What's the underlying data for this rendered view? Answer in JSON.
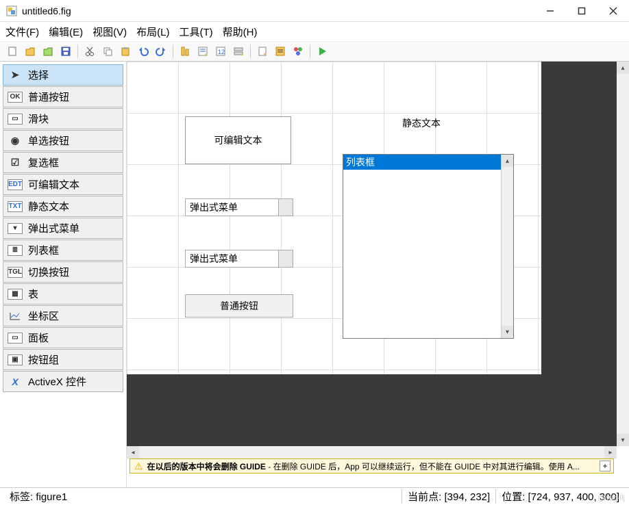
{
  "window": {
    "title": "untitled6.fig"
  },
  "menu": {
    "file": "文件(F)",
    "edit": "编辑(E)",
    "view": "视图(V)",
    "layout": "布局(L)",
    "tools": "工具(T)",
    "help": "帮助(H)"
  },
  "palette": {
    "select": "选择",
    "pushbutton": "普通按钮",
    "slider": "滑块",
    "radio": "单选按钮",
    "checkbox": "复选框",
    "edit": "可编辑文本",
    "text": "静态文本",
    "popup": "弹出式菜单",
    "listbox": "列表框",
    "toggle": "切换按钮",
    "table": "表",
    "axes": "坐标区",
    "panel": "面板",
    "buttongroup": "按钮组",
    "activex": "ActiveX 控件"
  },
  "canvas": {
    "editable_text": "可编辑文本",
    "static_text": "静态文本",
    "popup1": "弹出式菜单",
    "popup2": "弹出式菜单",
    "listbox_item": "列表框",
    "pushbutton": "普通按钮"
  },
  "warning": {
    "bold": "在以后的版本中将会删除 GUIDE",
    "rest": " - 在删除 GUIDE 后，App 可以继续运行，但不能在 GUIDE 中对其进行编辑。使用 A..."
  },
  "status": {
    "tag_label": "标签: ",
    "tag_value": "figure1",
    "curpoint_label": "当前点:  ",
    "curpoint_value": "[394, 232]",
    "pos_label": "位置: ",
    "pos_value": "[724, 937, 400, 300]"
  },
  "watermark": "@Jun-llj"
}
